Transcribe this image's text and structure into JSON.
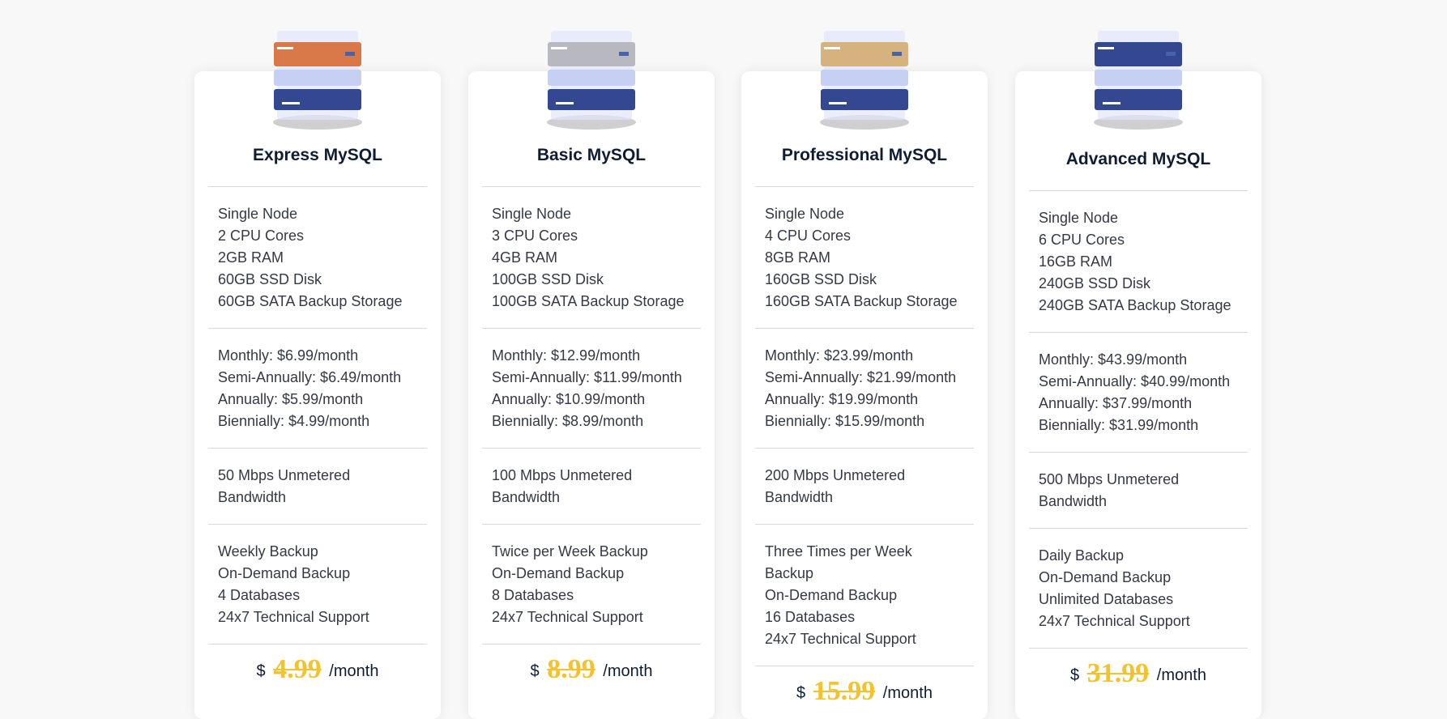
{
  "plans": [
    {
      "title": "Express MySQL",
      "accent_color": "#d9794a",
      "specs": [
        "Single Node",
        "2 CPU Cores",
        "2GB RAM",
        "60GB SSD Disk",
        "60GB SATA Backup Storage"
      ],
      "billing": [
        "Monthly: $6.99/month",
        "Semi-Annually: $6.49/month",
        "Annually: $5.99/month",
        "Biennially: $4.99/month"
      ],
      "bandwidth": [
        "50 Mbps Unmetered",
        "Bandwidth"
      ],
      "extras": [
        "Weekly Backup",
        "On-Demand Backup",
        "4 Databases",
        "24x7 Technical Support"
      ],
      "price": {
        "currency": "$",
        "amount": "4.99",
        "period": "/month"
      }
    },
    {
      "title": "Basic MySQL",
      "accent_color": "#b8b8c0",
      "specs": [
        "Single Node",
        "3 CPU Cores",
        "4GB RAM",
        "100GB SSD Disk",
        "100GB SATA Backup Storage"
      ],
      "billing": [
        "Monthly: $12.99/month",
        "Semi-Annually: $11.99/month",
        "Annually: $10.99/month",
        "Biennially: $8.99/month"
      ],
      "bandwidth": [
        "100 Mbps Unmetered",
        "Bandwidth"
      ],
      "extras": [
        "Twice per Week Backup",
        "On-Demand Backup",
        "8 Databases",
        "24x7 Technical Support"
      ],
      "price": {
        "currency": "$",
        "amount": "8.99",
        "period": "/month"
      }
    },
    {
      "title": "Professional MySQL",
      "accent_color": "#d6b27f",
      "specs": [
        "Single Node",
        "4 CPU Cores",
        "8GB RAM",
        "160GB SSD Disk",
        "160GB SATA Backup Storage"
      ],
      "billing": [
        "Monthly: $23.99/month",
        "Semi-Annually: $21.99/month",
        "Annually: $19.99/month",
        "Biennially: $15.99/month"
      ],
      "bandwidth": [
        "200 Mbps Unmetered",
        "Bandwidth"
      ],
      "extras": [
        "Three Times per Week",
        "Backup",
        "On-Demand Backup",
        "16 Databases",
        "24x7 Technical Support"
      ],
      "price": {
        "currency": "$",
        "amount": "15.99",
        "period": "/month"
      }
    },
    {
      "title": "Advanced MySQL",
      "accent_color": "#334891",
      "specs": [
        "Single Node",
        "6 CPU Cores",
        "16GB RAM",
        "240GB SSD Disk",
        "240GB SATA Backup Storage"
      ],
      "billing": [
        "Monthly: $43.99/month",
        "Semi-Annually: $40.99/month",
        "Annually: $37.99/month",
        "Biennially: $31.99/month"
      ],
      "bandwidth": [
        "500 Mbps Unmetered",
        "Bandwidth"
      ],
      "extras": [
        "Daily Backup",
        "On-Demand Backup",
        "Unlimited Databases",
        "24x7 Technical Support"
      ],
      "price": {
        "currency": "$",
        "amount": "31.99",
        "period": "/month"
      }
    }
  ],
  "colors": {
    "page_background": "#f8f8f8",
    "card_background": "#ffffff",
    "title_text": "#0f1d33",
    "body_text": "#333945",
    "price_highlight": "#f4c22c",
    "server_blue": "#334891",
    "server_glass": "#dfe5fb"
  },
  "icons": {
    "server_stack": "server-stack-icon"
  }
}
